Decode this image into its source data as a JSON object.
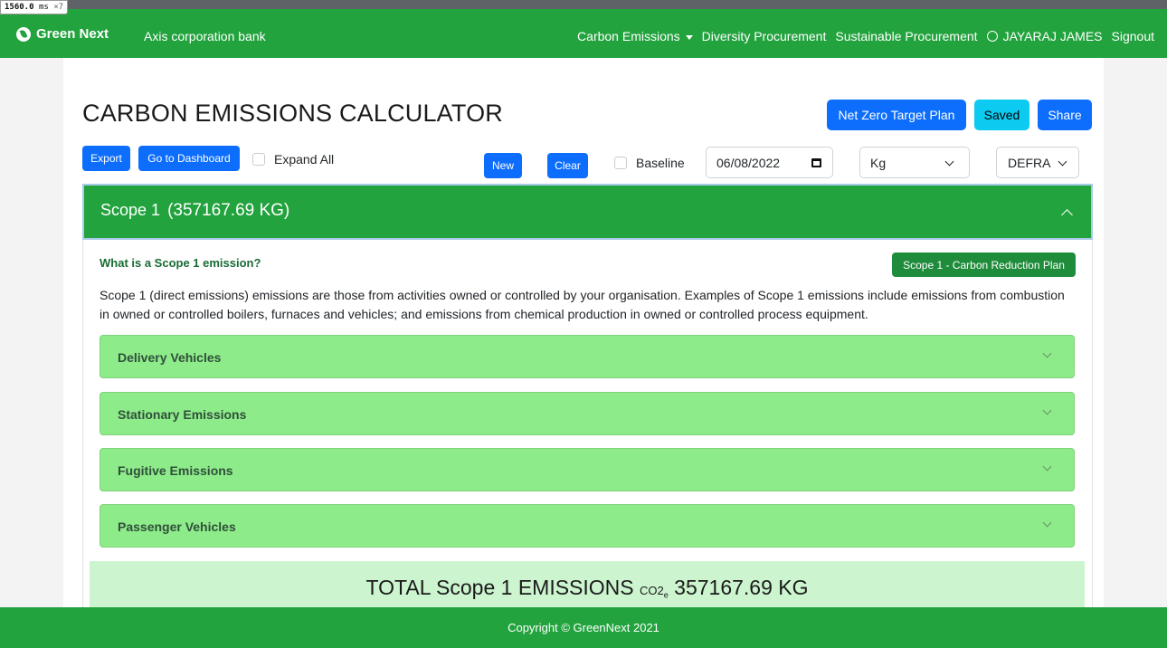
{
  "timing": {
    "value": "1560.0",
    "unit": "ms",
    "multiplier": "×7"
  },
  "navbar": {
    "brand": "Green Next",
    "org": "Axis corporation bank",
    "menu": [
      "Carbon Emissions",
      "Diversity Procurement",
      "Sustainable Procurement"
    ],
    "user": "JAYARAJ JAMES",
    "signout": "Signout"
  },
  "page": {
    "title": "CARBON EMISSIONS CALCULATOR"
  },
  "actions": {
    "net_zero": "Net Zero Target Plan",
    "saved": "Saved",
    "share": "Share",
    "export": "Export",
    "dashboard": "Go to Dashboard",
    "expand_all": "Expand All",
    "new": "New",
    "clear": "Clear",
    "baseline": "Baseline",
    "date": "06/08/2022",
    "unit": "Kg",
    "source": "DEFRA"
  },
  "scope": {
    "name": "Scope 1",
    "value": "(357167.69 KG)",
    "question": "What is a Scope 1 emission?",
    "plan_button": "Scope 1 - Carbon Reduction Plan",
    "description": "Scope 1 (direct emissions) emissions are those from activities owned or controlled by your organisation. Examples of Scope 1 emissions include emissions from combustion in owned or controlled boilers, furnaces and vehicles; and emissions from chemical production in owned or controlled process equipment.",
    "sections": [
      "Delivery Vehicles",
      "Stationary Emissions",
      "Fugitive Emissions",
      "Passenger Vehicles"
    ]
  },
  "total": {
    "label": "TOTAL Scope 1 EMISSIONS",
    "co2": "CO2",
    "co2_sub": "e",
    "value": "357167.69 KG"
  },
  "footer": {
    "text": "Copyright © GreenNext 2021"
  },
  "colors": {
    "primary_green": "#22a33e",
    "accordion_green": "#8eeb8a",
    "button_blue": "#0d6efd",
    "saved_cyan": "#0dcaf0"
  }
}
